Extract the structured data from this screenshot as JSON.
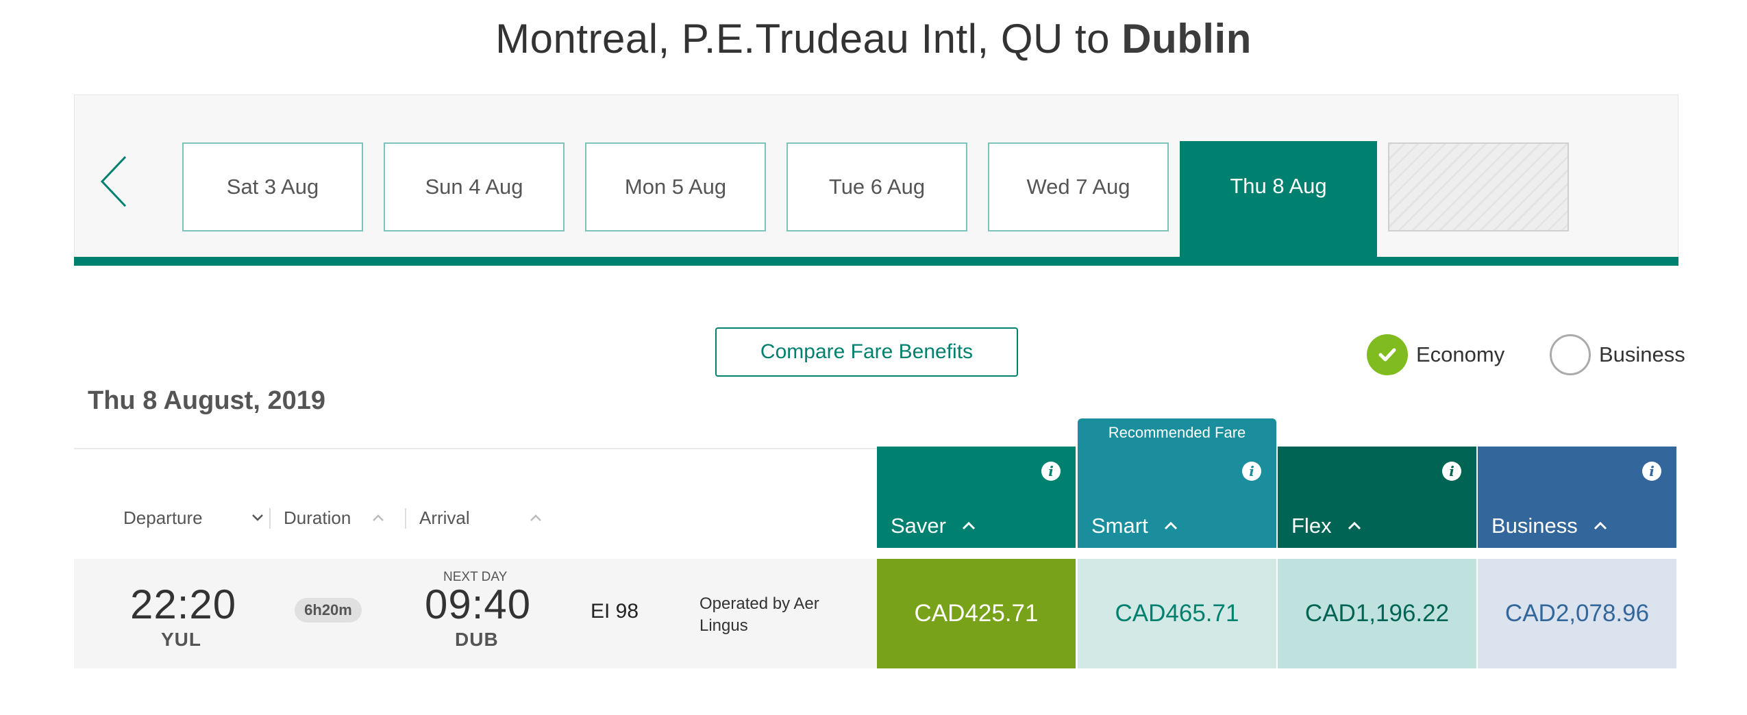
{
  "header": {
    "title_prefix": "Montreal, P.E.Trudeau Intl, QU to ",
    "title_destination": "Dublin"
  },
  "date_carousel": {
    "prev_icon": "chevron-left-icon",
    "dates": [
      {
        "label": "Sat 3 Aug"
      },
      {
        "label": "Sun 4 Aug"
      },
      {
        "label": "Mon 5 Aug"
      },
      {
        "label": "Tue 6 Aug"
      },
      {
        "label": "Wed 7 Aug"
      },
      {
        "label": "Thu 8 Aug",
        "selected": true
      },
      {
        "label": "",
        "disabled": true
      }
    ]
  },
  "compare_button": "Compare Fare Benefits",
  "cabin": {
    "economy": "Economy",
    "business": "Business",
    "selected": "economy"
  },
  "selected_date_heading": "Thu 8 August, 2019",
  "sort_headers": {
    "departure": "Departure",
    "duration": "Duration",
    "arrival": "Arrival"
  },
  "recommended_label": "Recommended Fare",
  "fares": [
    {
      "name": "Saver",
      "color": "#00806f"
    },
    {
      "name": "Smart",
      "color": "#1a8e9c"
    },
    {
      "name": "Flex",
      "color": "#006455"
    },
    {
      "name": "Business",
      "color": "#33679c"
    }
  ],
  "flight": {
    "departure_time": "22:20",
    "departure_code": "YUL",
    "duration": "6h20m",
    "next_day_label": "NEXT DAY",
    "arrival_time": "09:40",
    "arrival_code": "DUB",
    "flight_number": "EI 98",
    "operated_by": "Operated by Aer Lingus",
    "prices": [
      {
        "fare": "Saver",
        "price": "CAD425.71",
        "bg": "#78a21a",
        "fg": "#ffffff"
      },
      {
        "fare": "Smart",
        "price": "CAD465.71",
        "bg": "#d2e9e6",
        "fg": "#00806f"
      },
      {
        "fare": "Flex",
        "price": "CAD1,196.22",
        "bg": "#bfe2de",
        "fg": "#006455"
      },
      {
        "fare": "Business",
        "price": "CAD2,078.96",
        "bg": "#dbe4ee",
        "fg": "#33679c"
      }
    ]
  }
}
